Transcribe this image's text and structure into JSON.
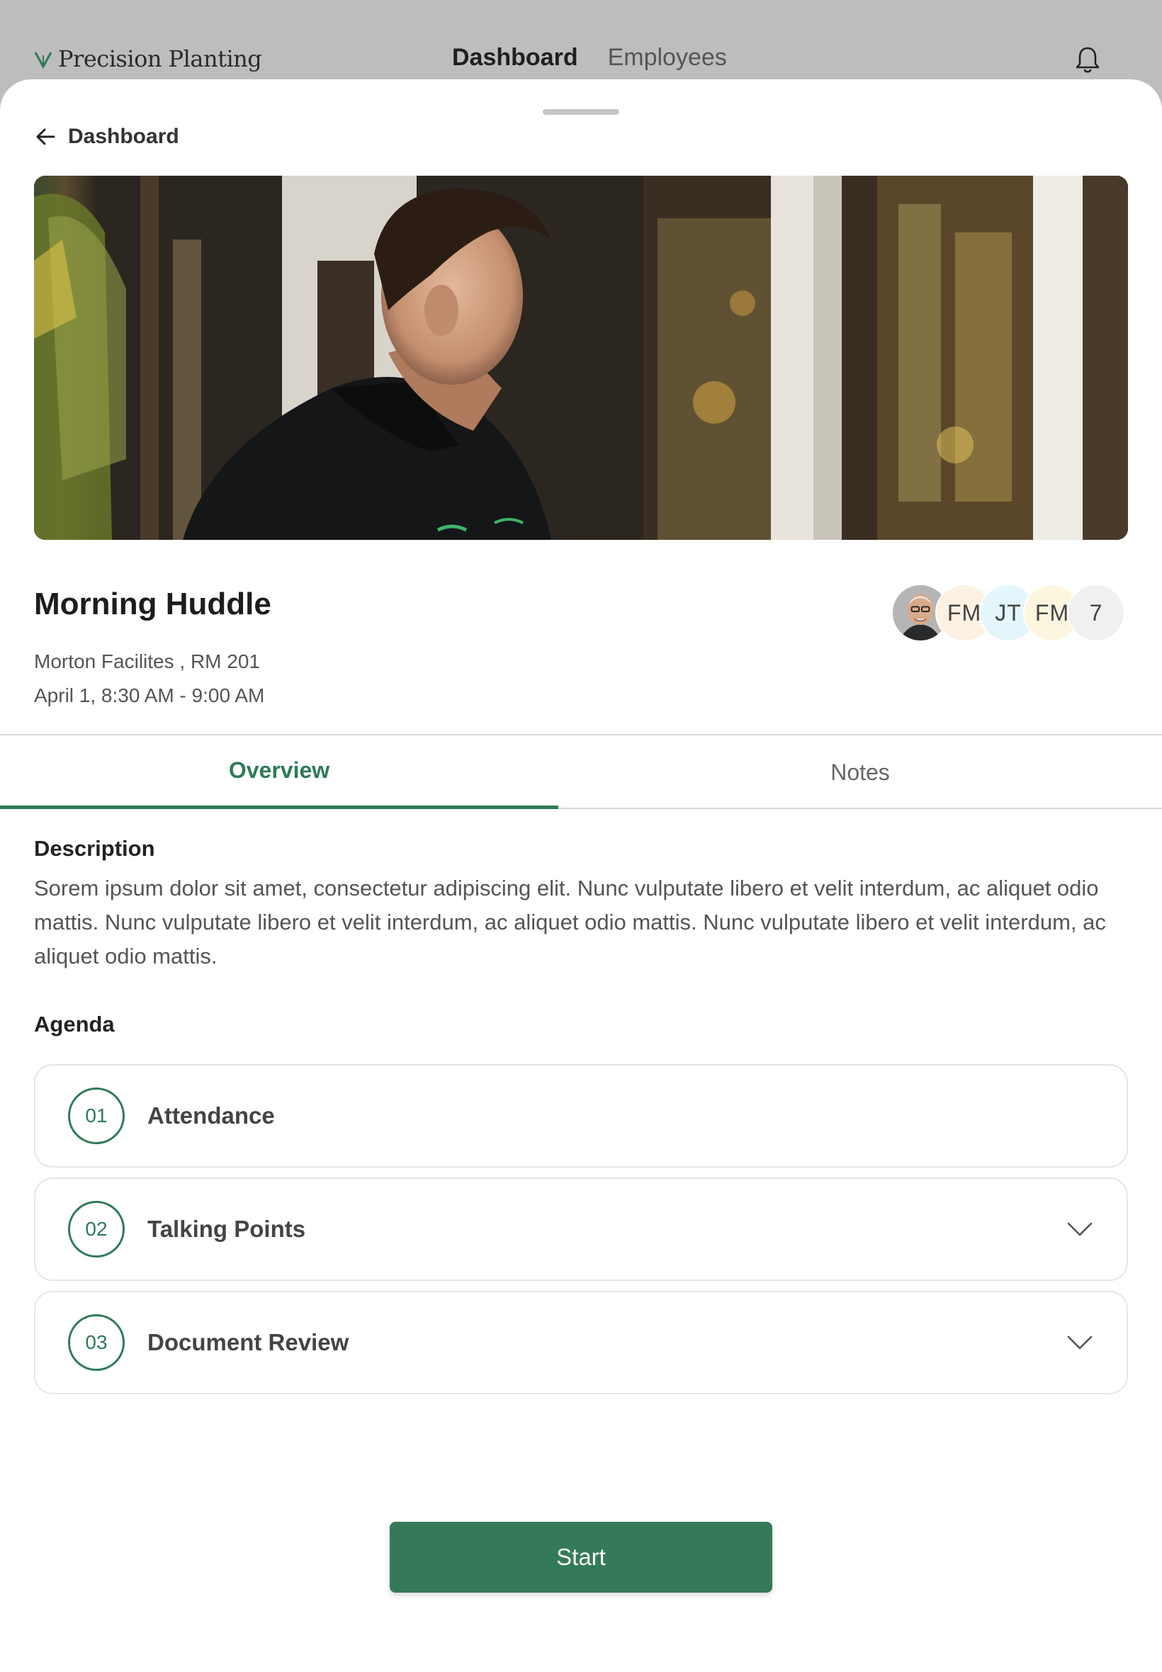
{
  "header": {
    "logo_text": "Precision Planting",
    "nav": [
      {
        "label": "Dashboard",
        "active": true
      },
      {
        "label": "Employees",
        "active": false
      }
    ],
    "notification_icon": "bell-icon"
  },
  "back": {
    "label": "Dashboard",
    "icon": "arrow-left-icon"
  },
  "meeting": {
    "title": "Morning Huddle",
    "location": "Morton Facilites , RM 201",
    "time": "April 1, 8:30 AM - 9:00 AM"
  },
  "attendees": {
    "initials": [
      "FM",
      "JT",
      "FM"
    ],
    "count": "7"
  },
  "tabs": [
    {
      "label": "Overview",
      "active": true
    },
    {
      "label": "Notes",
      "active": false
    }
  ],
  "description": {
    "label": "Description",
    "text": "Sorem ipsum dolor sit amet, consectetur adipiscing elit. Nunc vulputate libero et velit interdum, ac aliquet odio mattis. Nunc vulputate libero et velit interdum, ac aliquet odio mattis. Nunc vulputate libero et velit interdum, ac aliquet odio mattis."
  },
  "agenda": {
    "label": "Agenda",
    "items": [
      {
        "number": "01",
        "label": "Attendance",
        "expandable": false
      },
      {
        "number": "02",
        "label": "Talking Points",
        "expandable": true
      },
      {
        "number": "03",
        "label": "Document Review",
        "expandable": true
      }
    ]
  },
  "start_button": {
    "label": "Start"
  },
  "colors": {
    "accent": "#2f7a57",
    "button": "#357a58"
  }
}
